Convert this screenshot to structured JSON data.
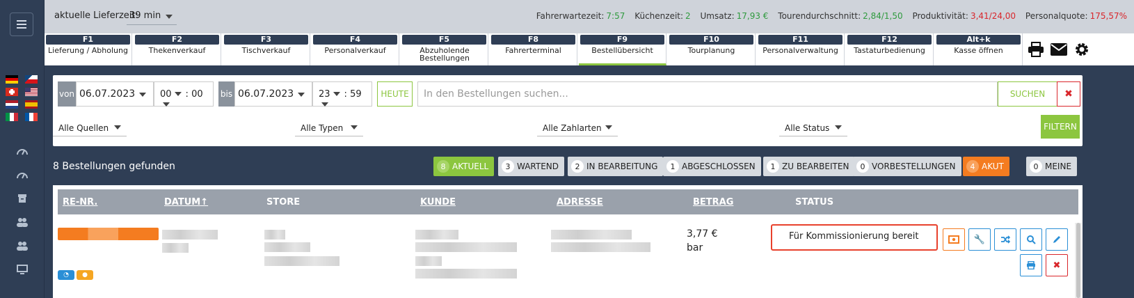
{
  "topbar": {
    "lieferzeit_label": "aktuelle Lieferzeit:",
    "lieferzeit_value": "39 min",
    "stats": [
      {
        "label": "Fahrerwartezeit:",
        "value": "7:57",
        "color": "#2f9a3e"
      },
      {
        "label": "Küchenzeit:",
        "value": "2",
        "color": "#2f9a3e"
      },
      {
        "label": "Umsatz:",
        "value": "17,93 €",
        "color": "#2f9a3e"
      },
      {
        "label": "Tourendurchschnitt:",
        "value": "2,84/1,50",
        "color": "#2f9a3e"
      },
      {
        "label": "Produktivität:",
        "value": "3,41/24,00",
        "color": "#d9262b"
      },
      {
        "label": "Personalquote:",
        "value": "175,57%",
        "color": "#d9262b"
      }
    ]
  },
  "tabs": [
    {
      "key": "F1",
      "label": "Lieferung / Abholung"
    },
    {
      "key": "F2",
      "label": "Thekenverkauf"
    },
    {
      "key": "F3",
      "label": "Tischverkauf"
    },
    {
      "key": "F4",
      "label": "Personalverkauf"
    },
    {
      "key": "F5",
      "label": "Abzuholende Bestellungen"
    },
    {
      "key": "F8",
      "label": "Fahrerterminal"
    },
    {
      "key": "F9",
      "label": "Bestellübersicht"
    },
    {
      "key": "F10",
      "label": "Tourplanung"
    },
    {
      "key": "F11",
      "label": "Personalverwaltung"
    },
    {
      "key": "F12",
      "label": "Tastaturbedienung"
    },
    {
      "key": "Alt+k",
      "label": "Kasse öffnen"
    }
  ],
  "filter": {
    "von_label": "von",
    "von_date": "06.07.2023",
    "von_hour": "00",
    "von_min": "00",
    "bis_label": "bis",
    "bis_date": "06.07.2023",
    "bis_hour": "23",
    "bis_min": "59",
    "heute_label": "HEUTE",
    "search_placeholder": "In den Bestellungen suchen...",
    "suchen_label": "SUCHEN",
    "clear_symbol": "✖",
    "quellen": "Alle Quellen",
    "typen": "Alle Typen",
    "zahlarten": "Alle Zahlarten",
    "status": "Alle Status",
    "filtern_label": "FILTERN"
  },
  "results": {
    "found_text": "8 Bestellungen gefunden",
    "chips": [
      {
        "count": "8",
        "label": "AKTUELL",
        "style": "green"
      },
      {
        "count": "3",
        "label": "WARTEND",
        "style": "grey"
      },
      {
        "count": "2",
        "label": "IN BEARBEITUNG",
        "style": "grey"
      },
      {
        "count": "1",
        "label": "ABGESCHLOSSEN",
        "style": "grey"
      },
      {
        "count": "1",
        "label": "ZU BEARBEITEN",
        "style": "grey"
      },
      {
        "count": "0",
        "label": "VORBESTELLUNGEN",
        "style": "grey"
      },
      {
        "count": "4",
        "label": "AKUT",
        "style": "orange"
      },
      {
        "count": "0",
        "label": "MEINE",
        "style": "grey"
      }
    ]
  },
  "table": {
    "headers": {
      "renr": "RE-NR.",
      "datum": "DATUM",
      "store": "STORE",
      "kunde": "KUNDE",
      "adresse": "ADRESSE",
      "betrag": "BETRAG",
      "status": "STATUS"
    },
    "rows": [
      {
        "betrag": "3,77 €",
        "zahlart": "bar",
        "status": "Für Kommissionierung bereit"
      }
    ]
  },
  "colors": {
    "accent_green": "#8cc63f",
    "accent_orange": "#f47c20",
    "sidebar": "#2f3e55",
    "danger": "#d9262b",
    "info": "#2a8fd6"
  }
}
